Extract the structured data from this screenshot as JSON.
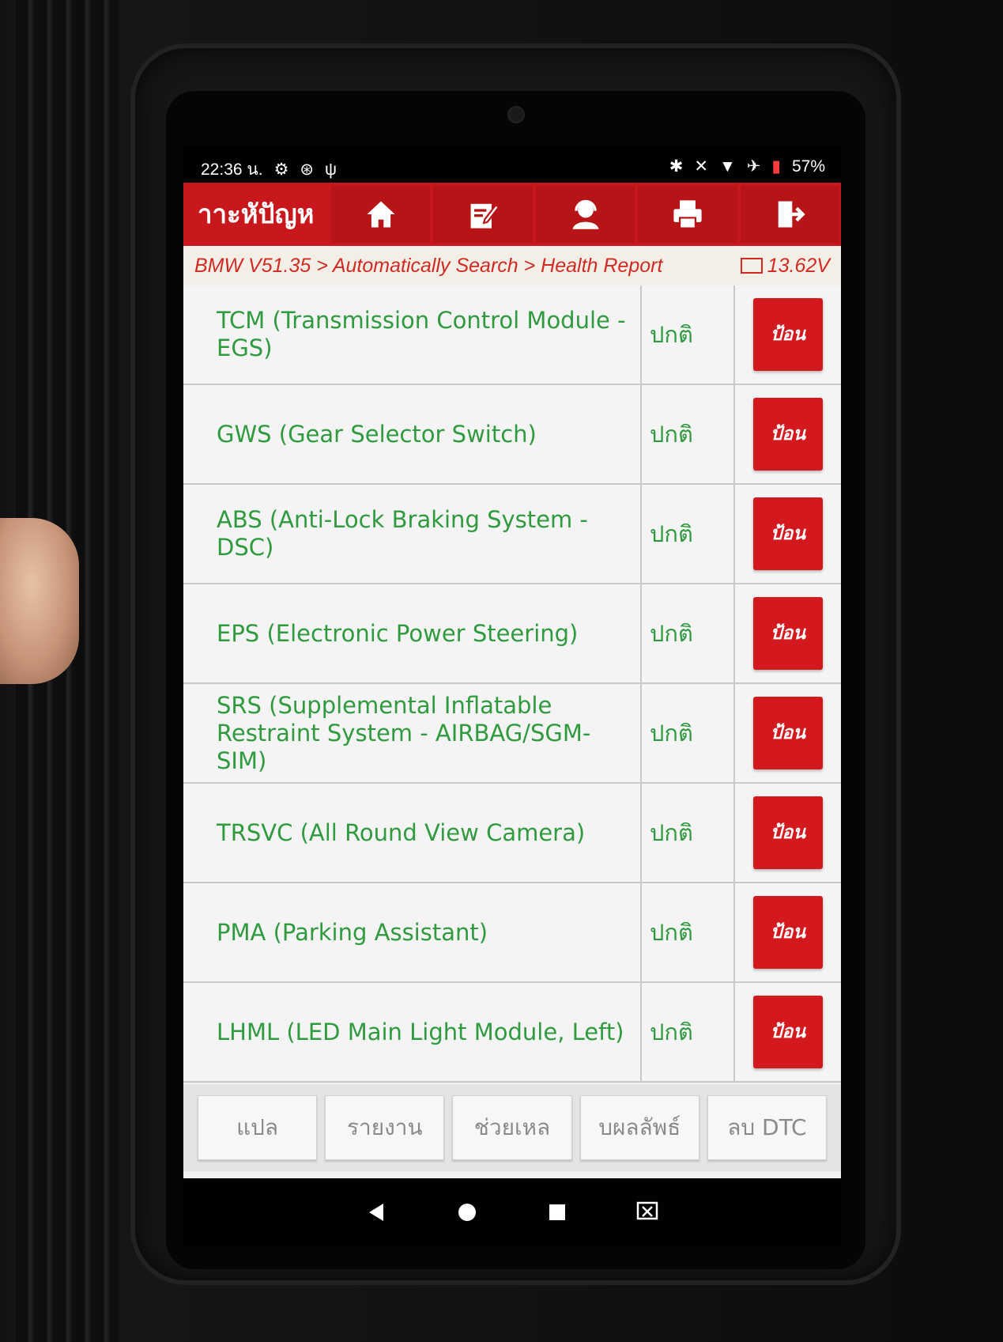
{
  "status_bar": {
    "time": "22:36 น.",
    "battery": "57%"
  },
  "header": {
    "title": "าาะหัปัญห",
    "buttons": [
      {
        "icon": "home-icon"
      },
      {
        "icon": "edit-icon"
      },
      {
        "icon": "support-icon"
      },
      {
        "icon": "print-icon"
      },
      {
        "icon": "exit-icon"
      }
    ]
  },
  "breadcrumb": {
    "path": "BMW V51.35 > Automatically Search > Health Report",
    "voltage": "13.62V"
  },
  "rows": [
    {
      "name": "TCM (Transmission Control Module - EGS)",
      "status": "ปกติ",
      "action": "ป้อน"
    },
    {
      "name": "GWS (Gear Selector Switch)",
      "status": "ปกติ",
      "action": "ป้อน"
    },
    {
      "name": "ABS (Anti-Lock Braking System - DSC)",
      "status": "ปกติ",
      "action": "ป้อน"
    },
    {
      "name": "EPS (Electronic Power Steering)",
      "status": "ปกติ",
      "action": "ป้อน"
    },
    {
      "name": "SRS (Supplemental Inflatable Restraint System - AIRBAG/SGM-SIM)",
      "status": "ปกติ",
      "action": "ป้อน"
    },
    {
      "name": "TRSVC (All Round View Camera)",
      "status": "ปกติ",
      "action": "ป้อน"
    },
    {
      "name": "PMA (Parking Assistant)",
      "status": "ปกติ",
      "action": "ป้อน"
    },
    {
      "name": "LHML (LED Main Light Module, Left)",
      "status": "ปกติ",
      "action": "ป้อน"
    }
  ],
  "bottom_buttons": [
    "แปล",
    "รายงาน",
    "ช่วยเหล",
    "บผลลัพธ์",
    "ลบ DTC"
  ],
  "colors": {
    "header_red": "#c8181e",
    "text_green": "#2f9a3e",
    "breadcrumb_red": "#d02a22"
  }
}
